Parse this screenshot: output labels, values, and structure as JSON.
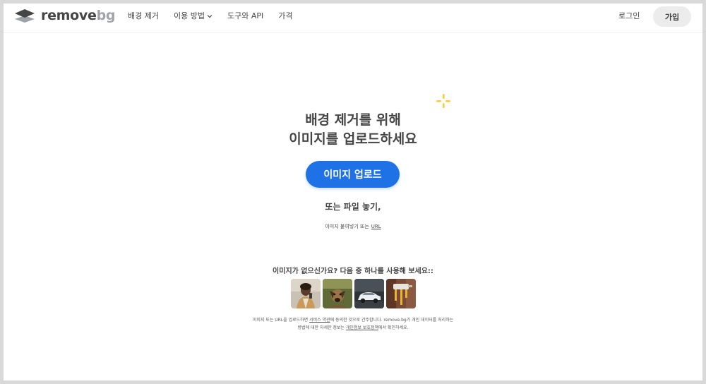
{
  "header": {
    "logo": {
      "word": "remove",
      "accent": "bg",
      "icon": "layers-logo-icon"
    },
    "nav": [
      {
        "label": "배경 제거"
      },
      {
        "label": "이용 방법",
        "has_dropdown": true
      },
      {
        "label": "도구와 API"
      },
      {
        "label": "가격"
      }
    ],
    "login_label": "로그인",
    "signup_label": "가입"
  },
  "hero": {
    "headline_line1": "배경 제거를 위해",
    "headline_line2": "이미지를 업로드하세요",
    "upload_button": "이미지 업로드",
    "drop_text": "또는 파일 놓기,",
    "paste_text": "이미지 붙여넣기 또는",
    "paste_link": "URL"
  },
  "samples": {
    "title": "이미지가 없으신가요? 다음 중 하나를 사용해 보세요::",
    "items": [
      "person-sample-icon",
      "dog-sample-icon",
      "car-sample-icon",
      "paint-roller-sample-icon"
    ]
  },
  "footnote": {
    "part1": "이미지 또는 URL을 업로드하면",
    "terms_link": "서비스 약관",
    "part2": "에 동의한 것으로 간주합니다. remove.bg가 개인 데이터를 처리하는",
    "part3": "방법에 대한 자세한 정보는",
    "privacy_link": "개인정보 보호정책",
    "part4": "에서 확인하세요."
  },
  "colors": {
    "primary": "#1f71e6",
    "text": "#454545",
    "sparkle": "#ffc93d",
    "signup_bg": "#ececec"
  }
}
